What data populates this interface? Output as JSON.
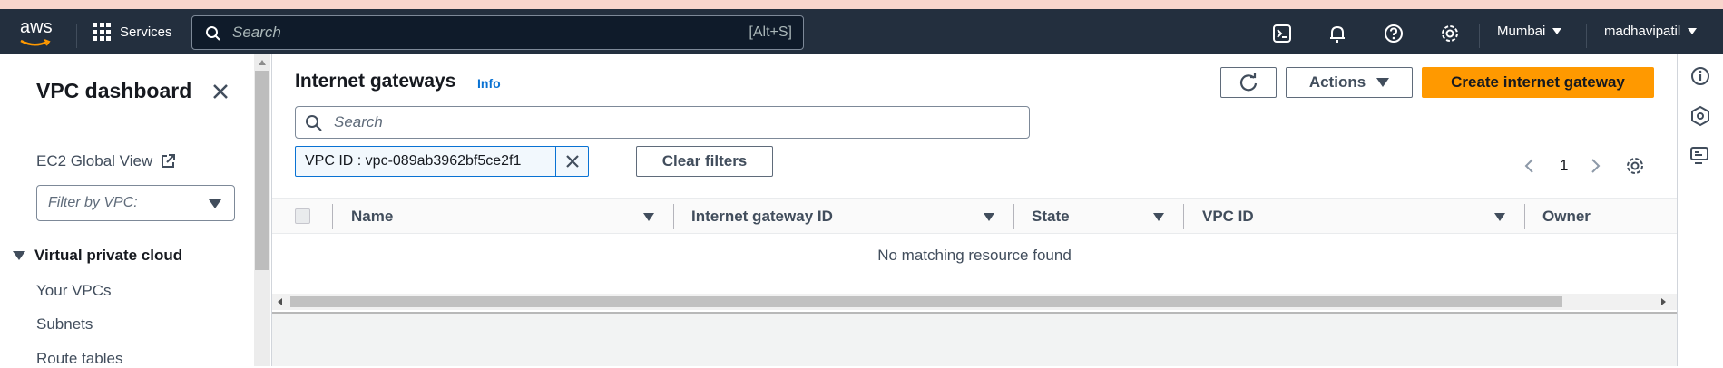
{
  "topbar": {
    "logo_text": "aws",
    "services_label": "Services",
    "search_placeholder": "Search",
    "search_shortcut": "[Alt+S]",
    "region": "Mumbai",
    "user": "madhavipatil"
  },
  "sidebar": {
    "title": "VPC dashboard",
    "ec2_global_view": "EC2 Global View",
    "filter_placeholder": "Filter by VPC:",
    "section": "Virtual private cloud",
    "items": [
      {
        "label": "Your VPCs"
      },
      {
        "label": "Subnets"
      },
      {
        "label": "Route tables"
      }
    ]
  },
  "main": {
    "title": "Internet gateways",
    "info": "Info",
    "actions_label": "Actions",
    "create_label": "Create internet gateway",
    "search_placeholder": "Search",
    "filter_token": "VPC ID : vpc-089ab3962bf5ce2f1",
    "clear_filters": "Clear filters",
    "page_number": "1",
    "columns": [
      "Name",
      "Internet gateway ID",
      "State",
      "VPC ID",
      "Owner"
    ],
    "empty_message": "No matching resource found"
  },
  "colors": {
    "topbar_bg": "#232f3e",
    "primary_button": "#ff9900",
    "link": "#0972d3"
  }
}
